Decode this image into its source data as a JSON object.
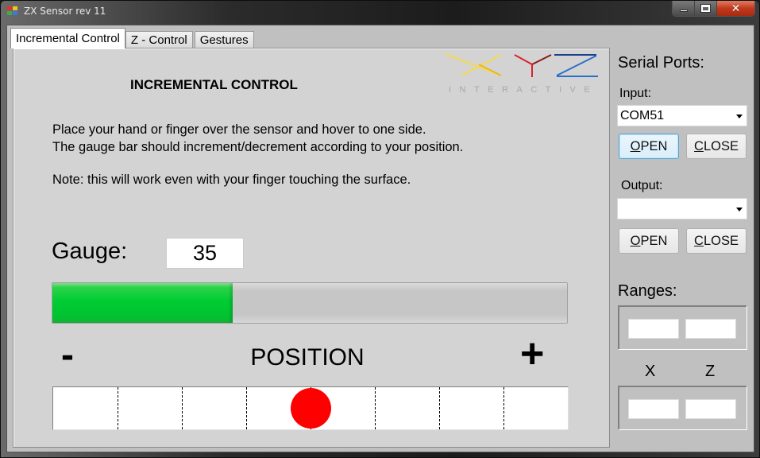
{
  "window": {
    "title": "ZX Sensor rev 11",
    "caption_buttons": {
      "minimize": "minimize",
      "maximize": "maximize",
      "close": "close"
    }
  },
  "tabs": [
    {
      "label": "Incremental Control",
      "active": true
    },
    {
      "label": "Z - Control",
      "active": false
    },
    {
      "label": "Gestures",
      "active": false
    }
  ],
  "panel": {
    "title": "INCREMENTAL CONTROL",
    "logo": {
      "letters": [
        "X",
        "Y",
        "Z"
      ],
      "subtitle": "INTERACTIVE",
      "colors": {
        "x": "#f5d94a",
        "y": "#d8232a",
        "z": "#2a6fc9"
      }
    },
    "instructions": [
      "Place your hand or finger over the sensor and hover to one side.",
      "The gauge bar should increment/decrement according to your position."
    ],
    "note": "Note: this will work even with your finger touching the surface.",
    "gauge": {
      "label": "Gauge:",
      "value": "35",
      "percent": 35,
      "fill_color": "#00cc33"
    },
    "position": {
      "minus_label": "-",
      "label": "POSITION",
      "plus_label": "+",
      "segments": 8,
      "dot_index": 3.5,
      "dot_color": "#ff0000"
    }
  },
  "sidebar": {
    "serial_ports_label": "Serial Ports:",
    "input": {
      "label": "Input:",
      "selected": "COM51",
      "open_label": "OPEN",
      "open_mnemonic": "O",
      "open_rest": "PEN",
      "close_mnemonic": "C",
      "close_rest": "LOSE"
    },
    "output": {
      "label": "Output:",
      "selected": "",
      "open_mnemonic": "O",
      "open_rest": "PEN",
      "close_mnemonic": "C",
      "close_rest": "LOSE"
    },
    "ranges": {
      "label": "Ranges:",
      "values": [
        "",
        ""
      ]
    },
    "axes": {
      "x_label": "X",
      "z_label": "Z",
      "values": [
        "",
        ""
      ]
    }
  }
}
